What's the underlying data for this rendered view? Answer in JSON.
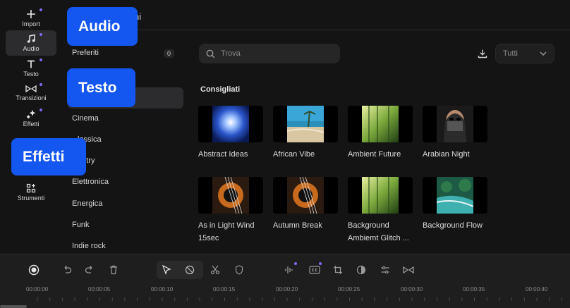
{
  "rail": {
    "items": [
      {
        "label": "Import",
        "icon": "plus-icon"
      },
      {
        "label": "Audio",
        "icon": "music-note-icon"
      },
      {
        "label": "Testo",
        "icon": "text-icon"
      },
      {
        "label": "Transizioni",
        "icon": "transition-icon"
      },
      {
        "label": "Effetti",
        "icon": "sparkle-icon"
      },
      {
        "label": "Strumenti",
        "icon": "grid-plus-icon"
      }
    ]
  },
  "callouts": {
    "audio": "Audio",
    "testo": "Testo",
    "effetti": "Effetti"
  },
  "header": {
    "title_fragment": "ni"
  },
  "categories": {
    "favorites": {
      "label": "Preferiti",
      "count": "0"
    },
    "items": [
      "Cinema",
      "lassica",
      "untry",
      "Elettronica",
      "Energica",
      "Funk",
      "Indie rock"
    ]
  },
  "search": {
    "placeholder": "Trova"
  },
  "filter": {
    "value": "Tutti"
  },
  "section": {
    "title": "Consigliati"
  },
  "cards": [
    {
      "title": "Abstract Ideas"
    },
    {
      "title": "African Vibe"
    },
    {
      "title": "Ambient Future"
    },
    {
      "title": "Arabian Night"
    },
    {
      "title": "As in Light Wind 15sec"
    },
    {
      "title": "Autumn Break"
    },
    {
      "title": "Background Ambiemt Glitch ..."
    },
    {
      "title": "Background Flow"
    }
  ],
  "timeline": {
    "ruler": [
      "00:00:00",
      "00:00:05",
      "00:00:10",
      "00:00:15",
      "00:00:20",
      "00:00:25",
      "00:00:30",
      "00:00:35",
      "00:00:40"
    ]
  },
  "colors": {
    "accent": "#1456f0",
    "dot": "#7c6cf5",
    "background": "#141414"
  }
}
